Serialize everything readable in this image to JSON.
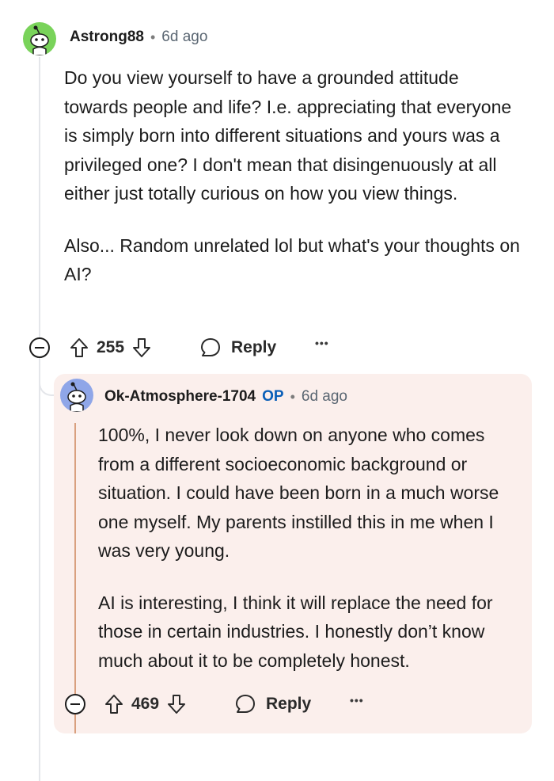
{
  "colors": {
    "op_highlight_bg": "#fbefec",
    "thread_line": "#e4e6ea",
    "op_thread_line": "#d9a07f",
    "op_label": "#0a5fb8",
    "avatar1_bg": "#79d35a",
    "avatar2_bg": "#8fa6e8"
  },
  "comment": {
    "author": "Astrong88",
    "separator": "•",
    "time": "6d ago",
    "paragraphs": [
      "Do you view yourself to have a grounded attitude towards people and life? I.e. appreciating that everyone is simply born into different situations and yours was a privileged one? I don't mean that disingenuously at all either just totally curious on how you view things.",
      "Also... Random unrelated lol but what's your thoughts on AI?"
    ],
    "votes": "255",
    "reply_label": "Reply",
    "more_label": "•••"
  },
  "reply": {
    "author": "Ok-Atmosphere-1704",
    "op_label": "OP",
    "separator": "•",
    "time": "6d ago",
    "paragraphs": [
      "100%, I never look down on anyone who comes from a different socioeconomic background or situation. I could have been born in a much worse one myself. My parents instilled this in me when I was very young.",
      "AI is interesting, I think it will replace the need for those in certain industries. I honestly don’t know much about it to be completely honest."
    ],
    "votes": "469",
    "reply_label": "Reply",
    "more_label": "•••"
  },
  "icons": [
    "reddit-avatar-icon",
    "upvote-icon",
    "downvote-icon",
    "comment-bubble-icon",
    "collapse-icon"
  ]
}
